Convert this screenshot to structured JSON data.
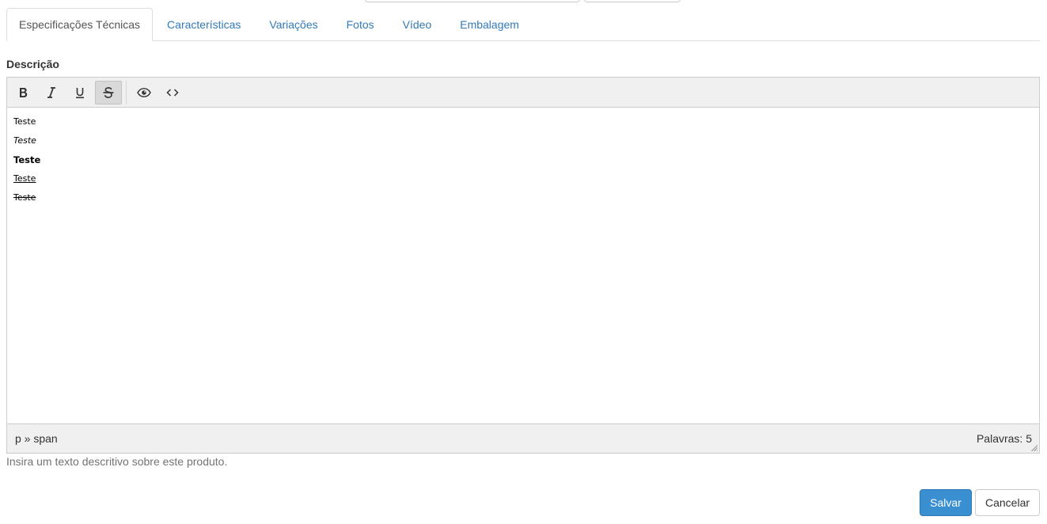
{
  "tabs": [
    {
      "label": "Especificações Técnicas",
      "active": true
    },
    {
      "label": "Características",
      "active": false
    },
    {
      "label": "Variações",
      "active": false
    },
    {
      "label": "Fotos",
      "active": false
    },
    {
      "label": "Vídeo",
      "active": false
    },
    {
      "label": "Embalagem",
      "active": false
    }
  ],
  "field": {
    "label": "Descrição",
    "help_text": "Insira um texto descritivo sobre este produto."
  },
  "toolbar": {
    "buttons": [
      {
        "icon": "bold-icon",
        "active": false
      },
      {
        "icon": "italic-icon",
        "active": false
      },
      {
        "icon": "underline-icon",
        "active": false
      },
      {
        "icon": "strikethrough-icon",
        "active": true
      },
      {
        "icon": "preview-eye-icon",
        "active": false
      },
      {
        "icon": "code-view-icon",
        "active": false
      }
    ]
  },
  "content": {
    "lines": [
      {
        "text": "Teste",
        "style": "normal"
      },
      {
        "text": "Teste",
        "style": "italic"
      },
      {
        "text": "Teste",
        "style": "bold"
      },
      {
        "text": "Teste",
        "style": "underline"
      },
      {
        "text": "Teste",
        "style": "strike"
      }
    ]
  },
  "statusbar": {
    "path": "p » span",
    "word_count": "Palavras: 5"
  },
  "actions": {
    "save_label": "Salvar",
    "cancel_label": "Cancelar"
  },
  "colors": {
    "primary": "#3a8fd1",
    "link": "#337ab7",
    "toolbar_bg": "#f0f0f0"
  }
}
